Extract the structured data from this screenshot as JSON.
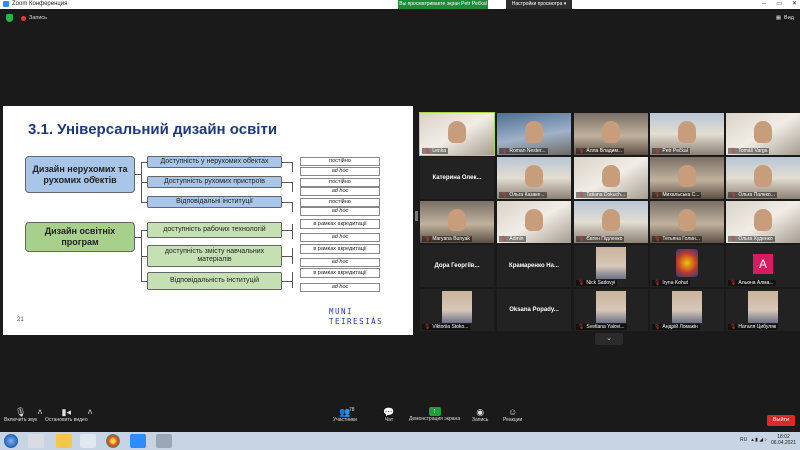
{
  "window": {
    "title": "Zoom Конференция"
  },
  "share_banner": "Вы просматриваете экран Petr Pečkal",
  "view_options": "Настройки просмотра ▾",
  "recording": "Запись",
  "view_button": "Вид",
  "slide": {
    "title": "3.1. Універсальний дизайн освіти",
    "page_number": "21",
    "logo_line1": "MUNI",
    "logo_line2": "TEIRESIÁS",
    "group1": {
      "label": "Дизайн нерухомих та рухомих об̓ектів",
      "items": [
        {
          "label": "Доступність у нерухомих об̓ектах",
          "tags": [
            "постійно",
            "ad hoc"
          ]
        },
        {
          "label": "Доступність рухомих пристроїв",
          "tags": [
            "постійно",
            "ad hoc"
          ]
        },
        {
          "label": "Відповідальні інституції",
          "tags": [
            "постійно",
            "ad hoc"
          ]
        }
      ]
    },
    "group2": {
      "label": "Дизайн освітніх програм",
      "items": [
        {
          "label": "доступність рабочих технологій",
          "tags": [
            "в рамках акредитації",
            "ad hoc"
          ]
        },
        {
          "label": "доступність змісту навчальних матеріалів",
          "tags": [
            "в рамках акредитації",
            "ad hoc"
          ]
        },
        {
          "label": "Відповідальність інституцій",
          "tags": [
            "в рамках акредитації",
            "ad hoc"
          ]
        }
      ]
    }
  },
  "participants": [
    {
      "name": "Lenka",
      "type": "video",
      "style": "v3",
      "active": true
    },
    {
      "name": "Roman Nester...",
      "type": "video",
      "style": "v4"
    },
    {
      "name": "Алла Владим...",
      "type": "video",
      "style": "v5"
    },
    {
      "name": "Petr Pečkal",
      "type": "video",
      "style": "v2"
    },
    {
      "name": "Tomáš Varga",
      "type": "video",
      "style": "v3"
    },
    {
      "name": "Катерина Олек...",
      "type": "text"
    },
    {
      "name": "Ольга Казаке...",
      "type": "video",
      "style": "v2"
    },
    {
      "name": "Tatiana Dokuch...",
      "type": "video",
      "style": "v3"
    },
    {
      "name": "Михальська С...",
      "type": "video",
      "style": "v5"
    },
    {
      "name": "Ольга Палеко...",
      "type": "video",
      "style": "v2"
    },
    {
      "name": "Maryana Bunyak",
      "type": "video",
      "style": "v5"
    },
    {
      "name": "Admin",
      "type": "video",
      "style": "v3"
    },
    {
      "name": "Євген Підленко",
      "type": "video",
      "style": "v2"
    },
    {
      "name": "Тетьяна Голин...",
      "type": "video",
      "style": "v5"
    },
    {
      "name": "Ольга Худенко",
      "type": "video",
      "style": "v3"
    },
    {
      "name": "Дора Георгіїв...",
      "type": "text"
    },
    {
      "name": "Крамаренко На...",
      "type": "text"
    },
    {
      "name": "Nick Sadovyi",
      "type": "portrait"
    },
    {
      "name": "Iryna Kohut",
      "type": "emblem"
    },
    {
      "name": "Альона Алма...",
      "type": "avatar",
      "letter": "A"
    },
    {
      "name": "Viktoriia Stoko...",
      "type": "portrait"
    },
    {
      "name": "Oksana Popady...",
      "type": "text"
    },
    {
      "name": "Svetlana Yalovi...",
      "type": "portrait"
    },
    {
      "name": "Андрій Ломакін",
      "type": "portrait"
    },
    {
      "name": "Наталя Цибуляк",
      "type": "portrait"
    }
  ],
  "gallery_more": "⌄",
  "toolbar": {
    "audio": "Включить звук",
    "video": "Остановить видео",
    "participants": "Участники",
    "participants_count": "78",
    "chat": "Чат",
    "share": "Демонстрация экрана",
    "record": "Запись",
    "reactions": "Реакции",
    "leave": "Выйти"
  },
  "taskbar": {
    "lang": "RU",
    "time": "18:02",
    "date": "06.04.2021"
  },
  "colors": {
    "accent_green": "#1f8b3a",
    "leave_red": "#e02828",
    "active_speaker": "#a7d84b",
    "slide_title": "#1f3a7a"
  }
}
